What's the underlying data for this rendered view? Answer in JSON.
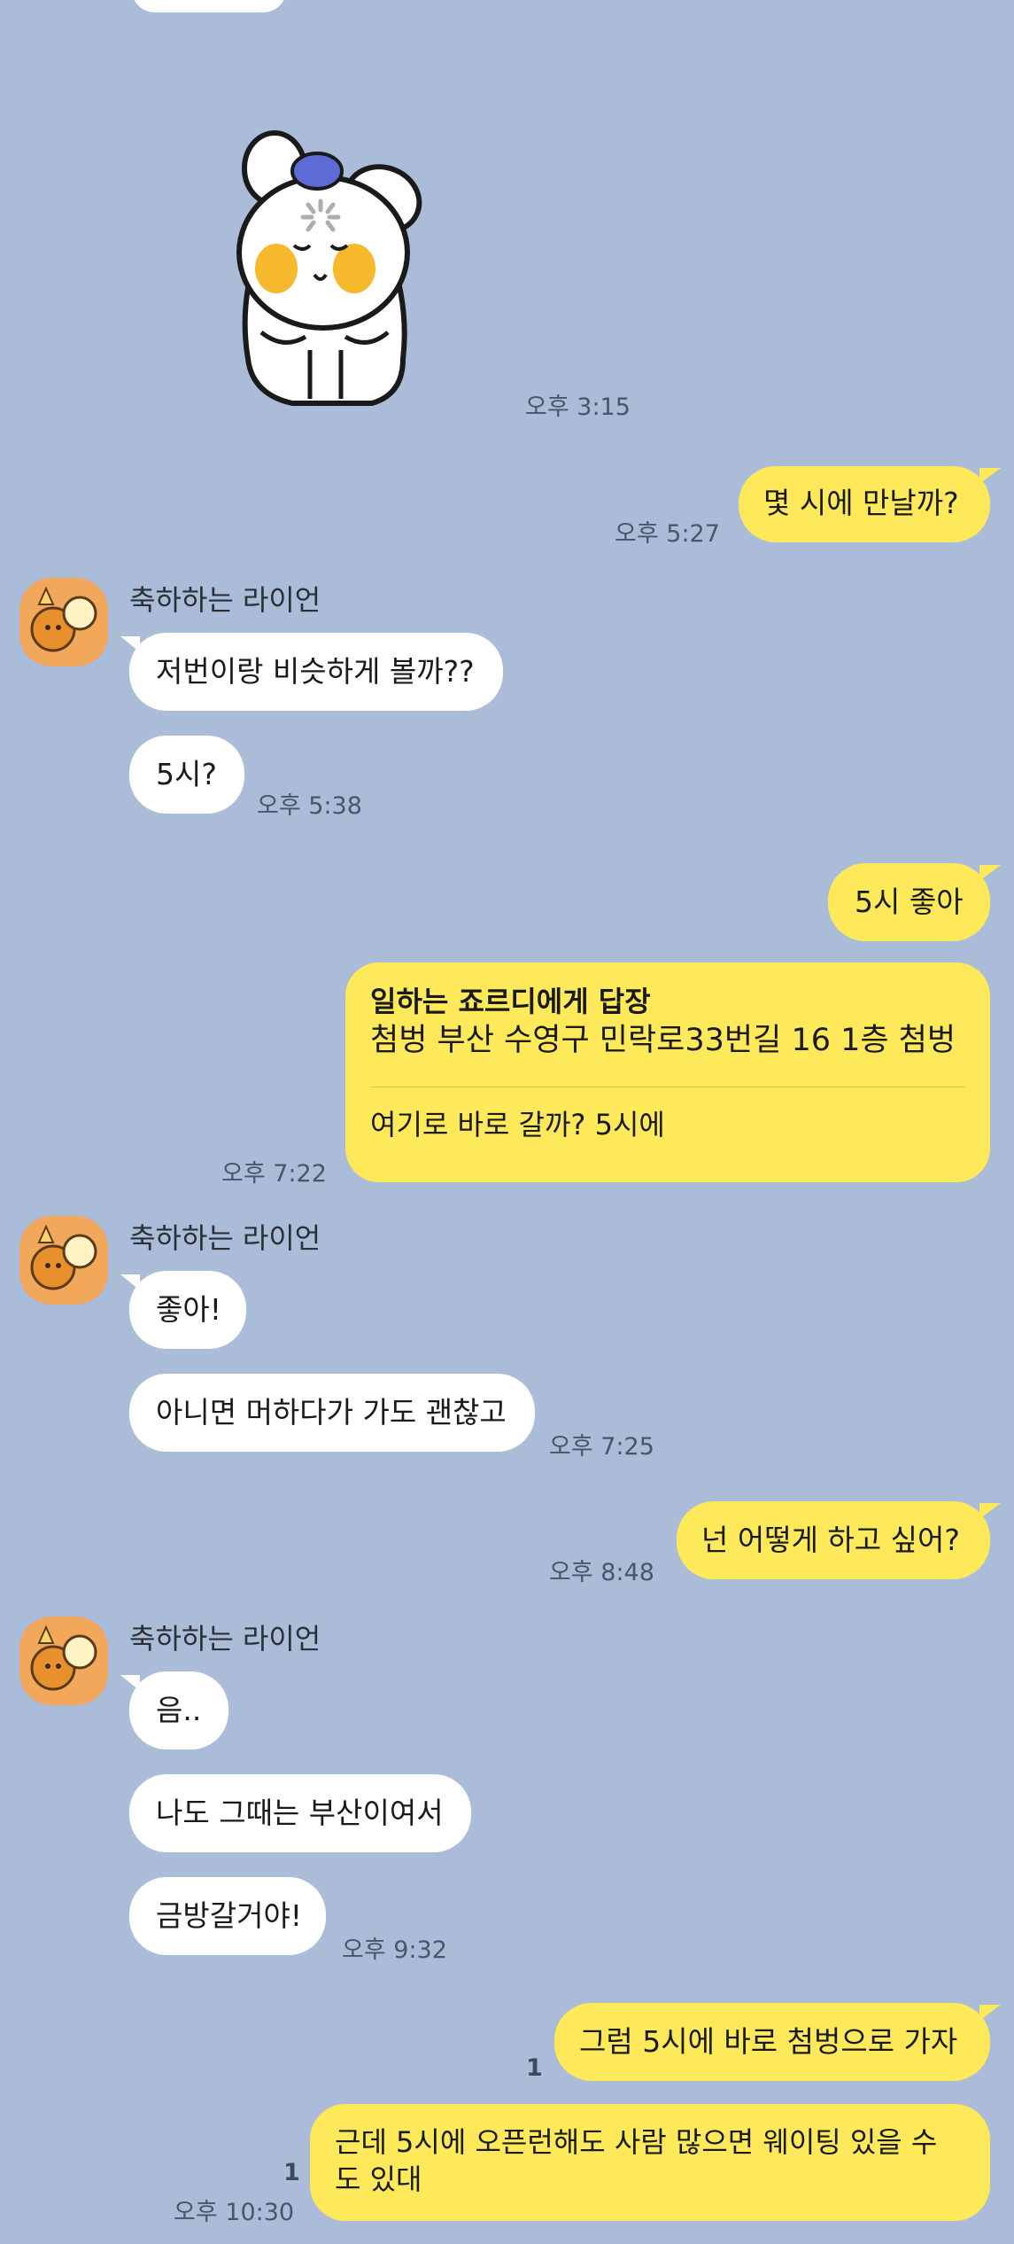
{
  "sticker_time": "오후 3:15",
  "conversation": {
    "sender_name": "축하하는 라이언",
    "msg_when_meet": "몇 시에 만날까?",
    "time_527": "오후 5:27",
    "msg_like_before": "저번이랑 비슷하게 볼까??",
    "msg_5": "5시?",
    "time_538": "오후 5:38",
    "msg_5_good": "5시 좋아",
    "reply_header": "일하는 죠르디에게 답장",
    "reply_quote": "첨벙 부산 수영구 민락로33번길 16 1층 첨벙",
    "reply_text": "여기로 바로 갈까? 5시에",
    "time_722": "오후 7:22",
    "msg_good": "좋아!",
    "msg_or_else": "아니면 머하다가 가도 괜찮고",
    "time_725": "오후 7:25",
    "msg_what_you_want": "넌 어떻게 하고 싶어?",
    "time_848": "오후 8:48",
    "msg_hmm": "음..",
    "msg_busan": "나도 그때는 부산이여서",
    "msg_soon": "금방갈거야!",
    "time_932": "오후 9:32",
    "msg_go_5": "그럼 5시에 바로 첨벙으로 가자",
    "unread_1": "1",
    "msg_waiting": "근데 5시에 오픈런해도 사람 많으면 웨이팅 있을 수 도 있대",
    "unread_2": "1",
    "time_1030": "오후 10:30"
  },
  "colors": {
    "background": "#abbcd8",
    "incoming_bubble": "#ffffff",
    "outgoing_bubble": "#fde95a"
  }
}
